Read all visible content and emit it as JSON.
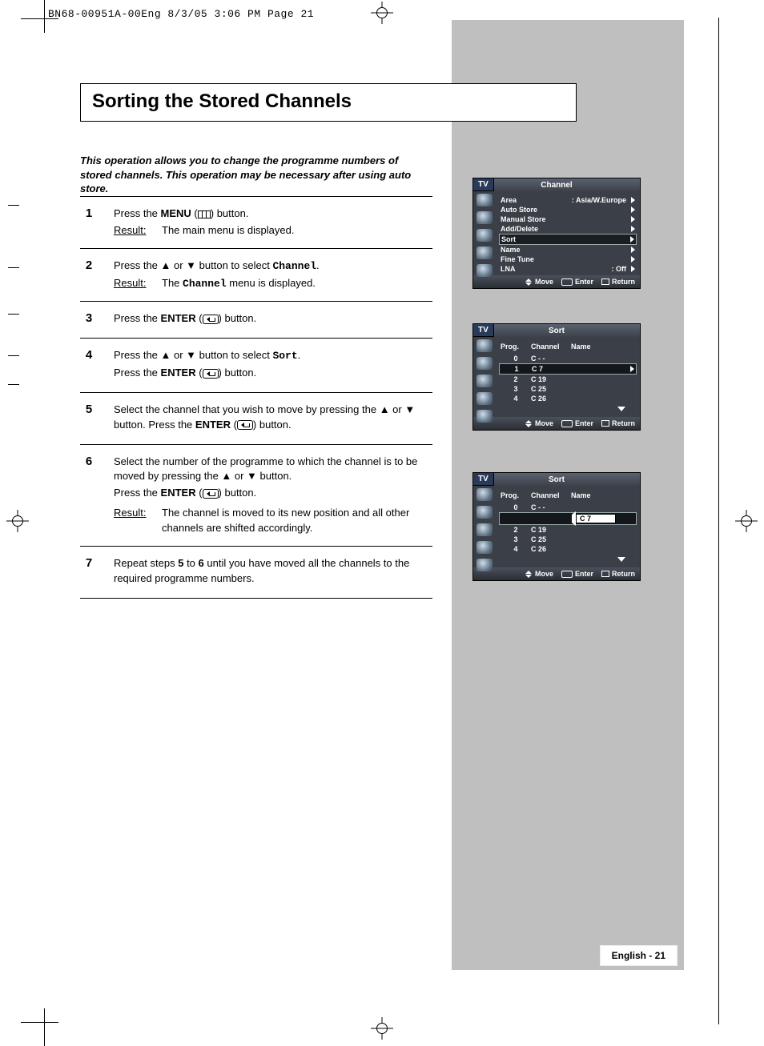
{
  "header_slug": "BN68-00951A-00Eng  8/3/05  3:06 PM  Page 21",
  "title": "Sorting the Stored Channels",
  "intro": "This operation allows you to change the programme numbers of stored channels. This operation may be necessary after using auto store.",
  "result_label": "Result",
  "words": {
    "menu": "MENU",
    "enter": "ENTER",
    "channel": "Channel",
    "sort": "Sort",
    "press_the": "Press the",
    "button_period": ") button.",
    "or": "or",
    "button_to_select": "button to select",
    "select_channel_move": "Select the channel that you wish to move by pressing the",
    "button_press_enter": "button. Press the",
    "select_number": "Select the number of the programme to which the channel is to be moved by pressing the",
    "repeat_a": "Repeat steps",
    "repeat_b": "to",
    "repeat_c": "until you have moved all the channels to the required programme numbers."
  },
  "steps": [
    {
      "n": "1",
      "line1_prefix": "Press the ",
      "strong": "MENU",
      "line1_suffix": " (",
      "line1_end": ") button.",
      "result": "The main menu is displayed."
    },
    {
      "n": "2",
      "line1_prefix": "Press the ▲ or ▼ button to select ",
      "mono": "Channel",
      "line1_end": ".",
      "result_prefix": "The ",
      "result_mono": "Channel",
      "result_suffix": " menu is displayed."
    },
    {
      "n": "3",
      "line1_prefix": "Press the ",
      "strong": "ENTER",
      "line1_suffix": " (",
      "line1_end": ") button."
    },
    {
      "n": "4",
      "line1_prefix": "Press the ▲ or ▼ button to select ",
      "mono": "Sort",
      "line1_end": ".",
      "line2_prefix": "Press the ",
      "line2_strong": "ENTER",
      "line2_suffix": " (",
      "line2_end": ") button."
    },
    {
      "n": "5",
      "line1": "Select the channel that you wish to move by pressing the ▲ or ▼ button. Press the ",
      "strong": "ENTER",
      "mid": " (",
      "end": ") button."
    },
    {
      "n": "6",
      "line1": "Select the number of the programme to which the channel is to be moved by pressing the ▲ or ▼ button.",
      "line2_prefix": "Press the ",
      "line2_strong": "ENTER",
      "line2_mid": " (",
      "line2_end": ") button.",
      "result": "The channel is moved to its new position and all other channels are shifted accordingly."
    },
    {
      "n": "7",
      "line_a": "Repeat steps ",
      "b": "5",
      "c": " to ",
      "d": "6",
      "e": " until you have moved all the channels to the required programme numbers."
    }
  ],
  "osd_common": {
    "tv": "TV",
    "hints": {
      "move": "Move",
      "enter": "Enter",
      "return": "Return"
    }
  },
  "osd1": {
    "title": "Channel",
    "items": [
      {
        "label": "Area",
        "value": ": Asia/W.Europe",
        "tri": true
      },
      {
        "label": "Auto Store",
        "tri": true
      },
      {
        "label": "Manual Store",
        "tri": true
      },
      {
        "label": "Add/Delete",
        "tri": true
      },
      {
        "label": "Sort",
        "tri": true,
        "selected": true
      },
      {
        "label": "Name",
        "tri": true
      },
      {
        "label": "Fine Tune",
        "tri": true
      },
      {
        "label": "LNA",
        "value": ": Off",
        "tri": true
      }
    ]
  },
  "osd2": {
    "title": "Sort",
    "head": {
      "prog": "Prog.",
      "ch": "Channel",
      "name": "Name"
    },
    "rows": [
      {
        "prog": "0",
        "ch": "C - -"
      },
      {
        "prog": "1",
        "ch": "C 7",
        "sel": true,
        "tri_r": true
      },
      {
        "prog": "2",
        "ch": "C 19"
      },
      {
        "prog": "3",
        "ch": "C 25"
      },
      {
        "prog": "4",
        "ch": "C 26"
      }
    ]
  },
  "osd3": {
    "title": "Sort",
    "head": {
      "prog": "Prog.",
      "ch": "Channel",
      "name": "Name"
    },
    "rows": [
      {
        "prog": "0",
        "ch": "C - -"
      },
      {
        "prog": "",
        "ch": "",
        "edit": "C 7",
        "tri_l": true,
        "sel": true
      },
      {
        "prog": "2",
        "ch": "C 19"
      },
      {
        "prog": "3",
        "ch": "C 25"
      },
      {
        "prog": "4",
        "ch": "C 26"
      }
    ]
  },
  "footer": "English - 21"
}
